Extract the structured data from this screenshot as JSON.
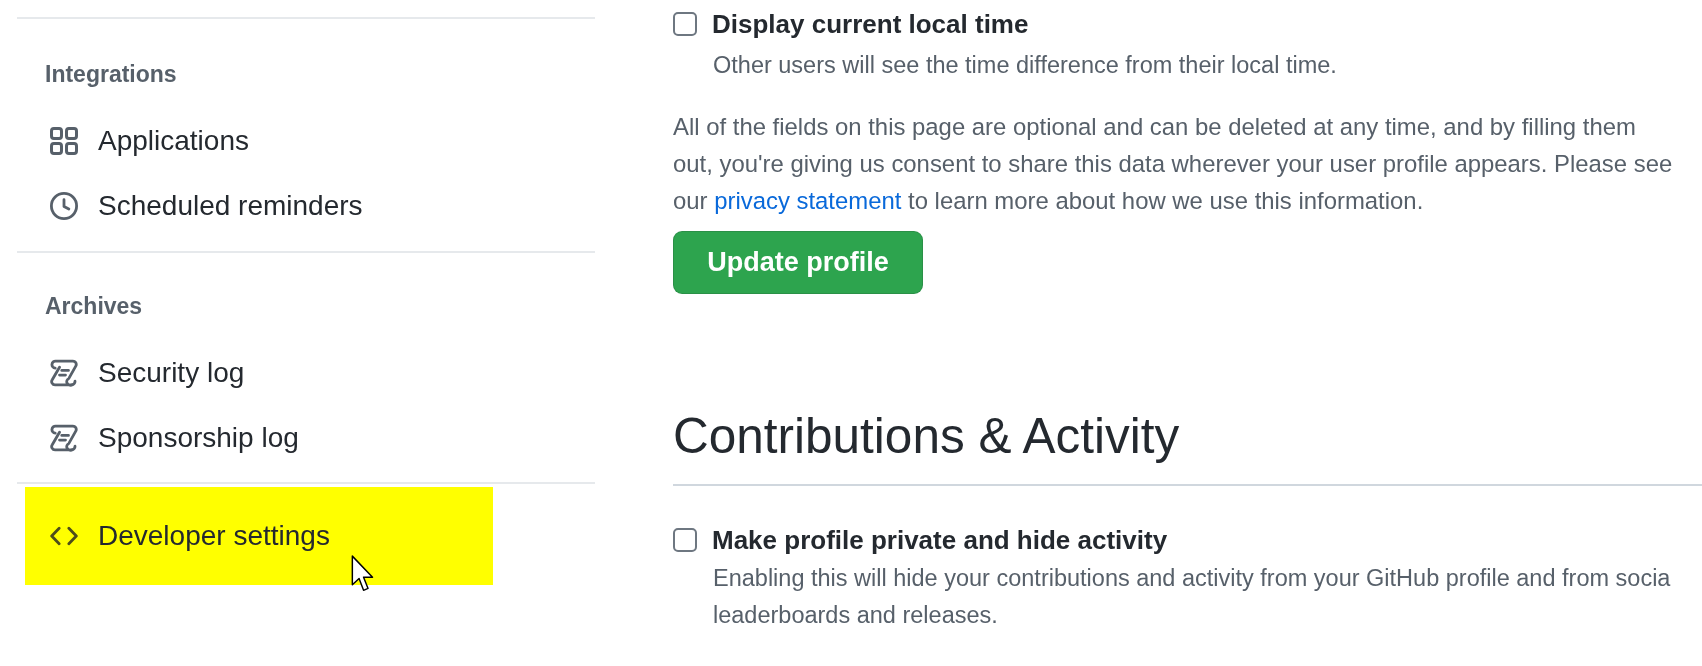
{
  "sidebar": {
    "sections": [
      {
        "heading": "Integrations",
        "items": [
          {
            "label": "Applications",
            "highlighted": false
          },
          {
            "label": "Scheduled reminders",
            "highlighted": false
          }
        ]
      },
      {
        "heading": "Archives",
        "items": [
          {
            "label": "Security log",
            "highlighted": false
          },
          {
            "label": "Sponsorship log",
            "highlighted": false
          }
        ]
      },
      {
        "items": [
          {
            "label": "Developer settings",
            "highlighted": true
          }
        ]
      }
    ]
  },
  "profile_settings": {
    "options": [
      {
        "label": "Display current local time",
        "description": [
          "Other users will see the time difference from their local time."
        ],
        "checked": false
      }
    ],
    "notice": {
      "before": "All of the fields on this page are optional and can be deleted at any time, and by filling them out, you're giving us consent to share this data wherever your user profile appears. Please see our",
      "link": "privacy statement",
      "after": "to learn more about how we use this information."
    },
    "submit_button": "Update profile"
  },
  "contributions": {
    "title": "Contributions & Activity",
    "options": [
      {
        "label": "Make profile private and hide activity",
        "description": [
          "Enabling this will hide your contributions and activity from your GitHub profile and from socia",
          "leaderboards and releases."
        ],
        "checked": false
      }
    ]
  }
}
